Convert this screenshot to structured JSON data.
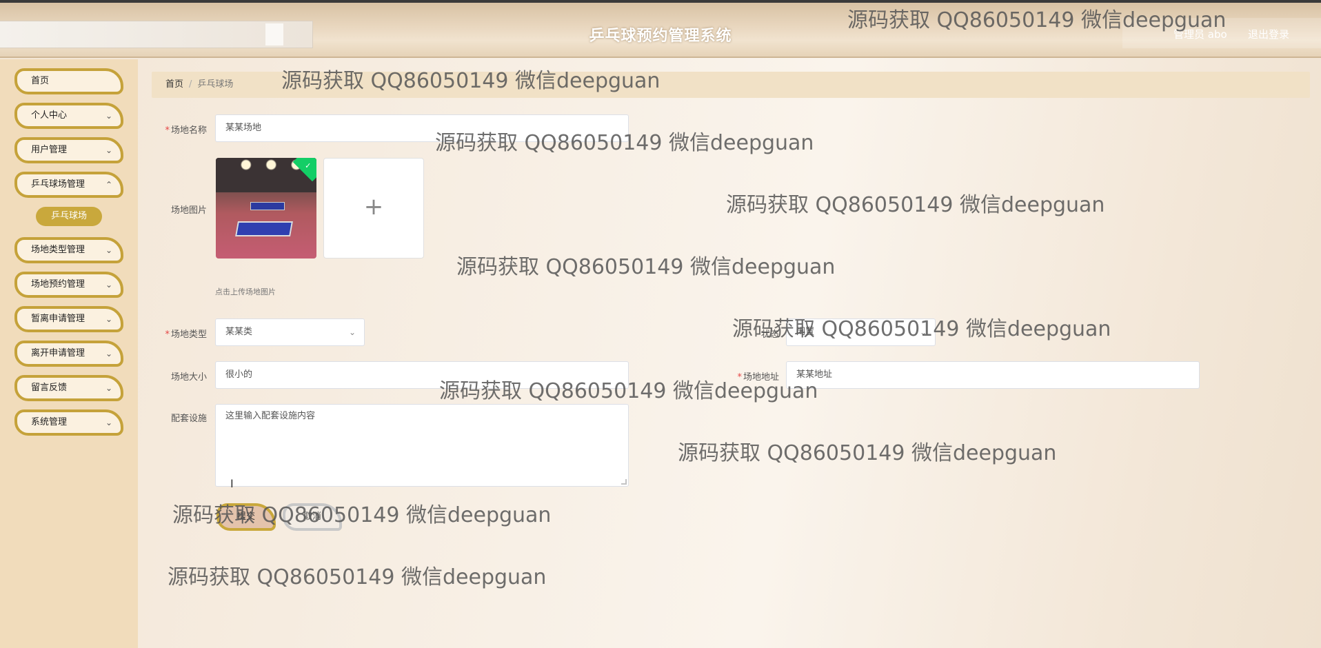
{
  "header": {
    "title": "乒乓球预约管理系统",
    "admin": "管理员 abo",
    "logout": "退出登录"
  },
  "sidebar": {
    "items": [
      {
        "label": "首页",
        "chevron": false
      },
      {
        "label": "个人中心",
        "chevron": true
      },
      {
        "label": "用户管理",
        "chevron": true
      },
      {
        "label": "乒乓球场管理",
        "chevron": true
      },
      {
        "label": "场地类型管理",
        "chevron": true
      },
      {
        "label": "场地预约管理",
        "chevron": true
      },
      {
        "label": "暂离申请管理",
        "chevron": true
      },
      {
        "label": "离开申请管理",
        "chevron": true
      },
      {
        "label": "留言反馈",
        "chevron": true
      },
      {
        "label": "系统管理",
        "chevron": true
      }
    ],
    "active_sub": "乒乓球场"
  },
  "breadcrumb": {
    "home": "首页",
    "separator": "/",
    "current": "乒乓球场"
  },
  "form": {
    "name": {
      "label": "场地名称",
      "value": "某某场地"
    },
    "image": {
      "label": "场地图片",
      "hint": "点击上传场地图片",
      "add": "+"
    },
    "type": {
      "label": "场地类型",
      "value": "某某类"
    },
    "status": {
      "label": "状态",
      "value": "闲置"
    },
    "size": {
      "label": "场地大小",
      "value": "很小的"
    },
    "address": {
      "label": "场地地址",
      "value": "某某地址"
    },
    "facilities": {
      "label": "配套设施",
      "value": "这里输入配套设施内容"
    },
    "submit": "提交",
    "cancel": "取消"
  },
  "watermark": "源码获取 QQ86050149 微信deepguan"
}
